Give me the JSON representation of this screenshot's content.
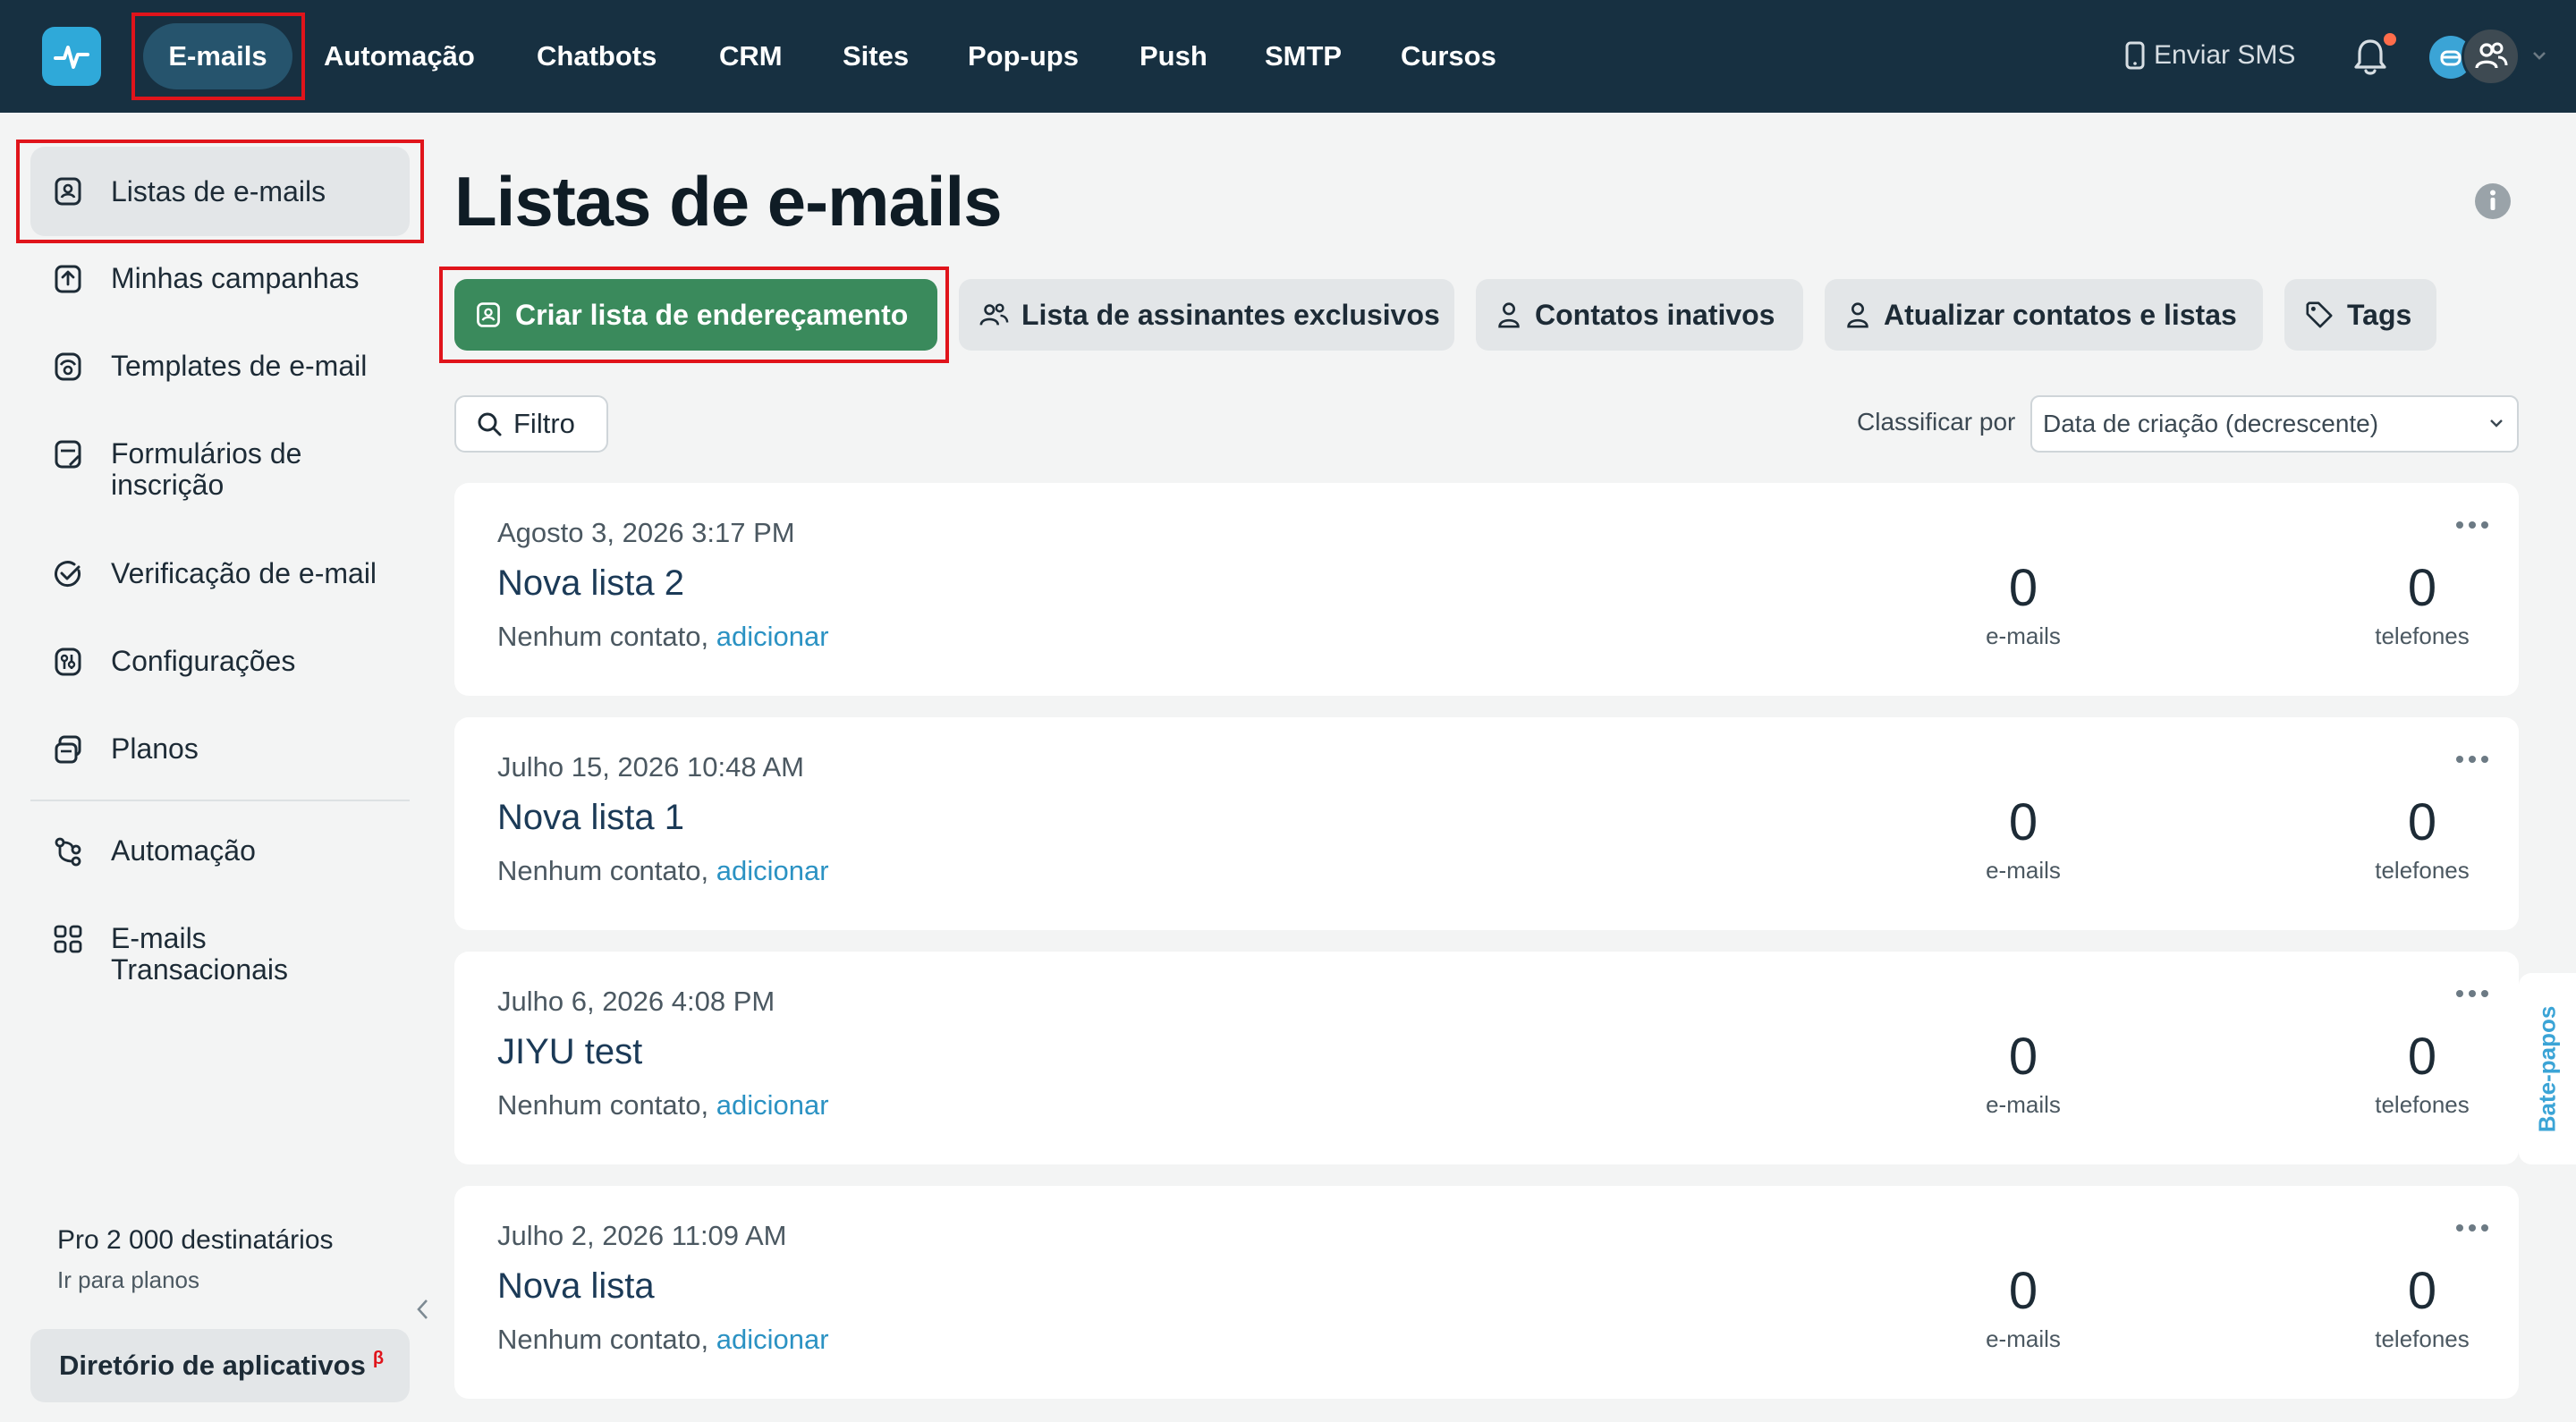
{
  "header": {
    "nav": [
      {
        "label": "E-mails",
        "active": true
      },
      {
        "label": "Automação"
      },
      {
        "label": "Chatbots"
      },
      {
        "label": "CRM"
      },
      {
        "label": "Sites"
      },
      {
        "label": "Pop-ups"
      },
      {
        "label": "Push"
      },
      {
        "label": "SMTP"
      },
      {
        "label": "Cursos"
      }
    ],
    "sms_label": "Enviar SMS",
    "icons": [
      "logo-icon",
      "phone-icon",
      "bell-icon",
      "bot-avatar-icon",
      "users-avatar-icon",
      "chevron-down-icon"
    ]
  },
  "sidebar": {
    "items": [
      {
        "label": "Listas de e-mails",
        "active": true,
        "icon": "contact-book-icon"
      },
      {
        "label": "Minhas campanhas",
        "icon": "campaign-icon"
      },
      {
        "label": "Templates de e-mail",
        "icon": "template-icon"
      },
      {
        "label": "Formulários de inscrição",
        "icon": "form-icon"
      },
      {
        "label": "Verificação de e-mail",
        "icon": "check-circle-icon"
      },
      {
        "label": "Configurações",
        "icon": "settings-icon"
      },
      {
        "label": "Planos",
        "icon": "plans-icon"
      },
      {
        "label": "Automação",
        "icon": "automation-icon"
      },
      {
        "label": "E-mails Transacionais",
        "icon": "grid-icon"
      }
    ],
    "plan_title": "Pro 2 000 destinatários",
    "plan_link": "Ir para planos",
    "app_directory": "Diretório de aplicativos",
    "app_directory_badge": "β"
  },
  "main": {
    "title": "Listas de e-mails",
    "actions": [
      {
        "label": "Criar lista de endereçamento",
        "primary": true
      },
      {
        "label": "Lista de assinantes exclusivos"
      },
      {
        "label": "Contatos inativos"
      },
      {
        "label": "Atualizar contatos e listas"
      },
      {
        "label": "Tags"
      }
    ],
    "filter_label": "Filtro",
    "sort_label": "Classificar por",
    "sort_value": "Data de criação (decrescente)",
    "lists": [
      {
        "date": "Agosto 3, 2026 3:17 PM",
        "name": "Nova lista 2",
        "sub": "Nenhum contato,",
        "add": "adicionar",
        "emails": "0",
        "emails_label": "e-mails",
        "phones": "0",
        "phones_label": "telefones"
      },
      {
        "date": "Julho 15, 2026 10:48 AM",
        "name": "Nova lista 1",
        "sub": "Nenhum contato,",
        "add": "adicionar",
        "emails": "0",
        "emails_label": "e-mails",
        "phones": "0",
        "phones_label": "telefones"
      },
      {
        "date": "Julho 6, 2026 4:08 PM",
        "name": "JIYU test",
        "sub": "Nenhum contato,",
        "add": "adicionar",
        "emails": "0",
        "emails_label": "e-mails",
        "phones": "0",
        "phones_label": "telefones"
      },
      {
        "date": "Julho 2, 2026 11:09 AM",
        "name": "Nova lista",
        "sub": "Nenhum contato,",
        "add": "adicionar",
        "emails": "0",
        "emails_label": "e-mails",
        "phones": "0",
        "phones_label": "telefones"
      }
    ]
  },
  "chat_tab": "Bate-papos",
  "colors": {
    "topbar": "#173041",
    "active_pill": "#26546d",
    "primary": "#3a8a5c",
    "link": "#2b92c3",
    "highlight": "#e0141b"
  }
}
